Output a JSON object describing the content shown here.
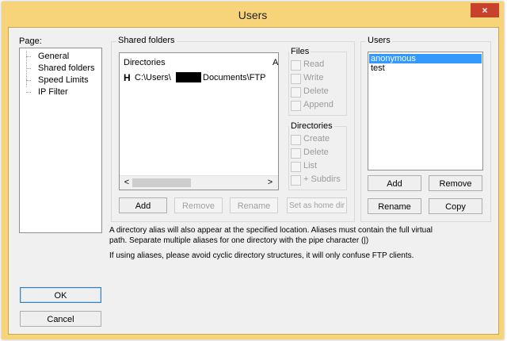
{
  "window": {
    "title": "Users",
    "close_glyph": "×"
  },
  "page_panel": {
    "label": "Page:",
    "items": [
      {
        "label": "General"
      },
      {
        "label": "Shared folders"
      },
      {
        "label": "Speed Limits"
      },
      {
        "label": "IP Filter"
      }
    ]
  },
  "shared_folders": {
    "group_label": "Shared folders",
    "list_header": "Directories",
    "list_header_right": "A",
    "entries": [
      {
        "flag": "H",
        "path_start": "C:\\Users\\",
        "path_end": "Documents\\FTP"
      }
    ],
    "scroll_left": "<",
    "scroll_right": ">",
    "buttons": {
      "add": "Add",
      "remove": "Remove",
      "rename": "Rename",
      "set_home": "Set as home dir"
    }
  },
  "files_group": {
    "label": "Files",
    "options": [
      {
        "label": "Read"
      },
      {
        "label": "Write"
      },
      {
        "label": "Delete"
      },
      {
        "label": "Append"
      }
    ]
  },
  "directories_group": {
    "label": "Directories",
    "options": [
      {
        "label": "Create"
      },
      {
        "label": "Delete"
      },
      {
        "label": "List"
      },
      {
        "label": "+ Subdirs"
      }
    ]
  },
  "users_panel": {
    "label": "Users",
    "users": [
      {
        "name": "anonymous",
        "selected": true
      },
      {
        "name": "test",
        "selected": false
      }
    ],
    "buttons": {
      "add": "Add",
      "remove": "Remove",
      "rename": "Rename",
      "copy": "Copy"
    }
  },
  "info": {
    "line1": "A directory alias will also appear at the specified location. Aliases must contain the full virtual",
    "line2": "path. Separate multiple aliases for one directory with the pipe character (|)",
    "line3": "If using aliases, please avoid cyclic directory structures, it will only confuse FTP clients."
  },
  "footer": {
    "ok": "OK",
    "cancel": "Cancel"
  },
  "colors": {
    "title_bar": "#f7d47a",
    "close_button": "#c7412d",
    "selection": "#3399ff",
    "dialog_bg": "#f0f0f0"
  }
}
